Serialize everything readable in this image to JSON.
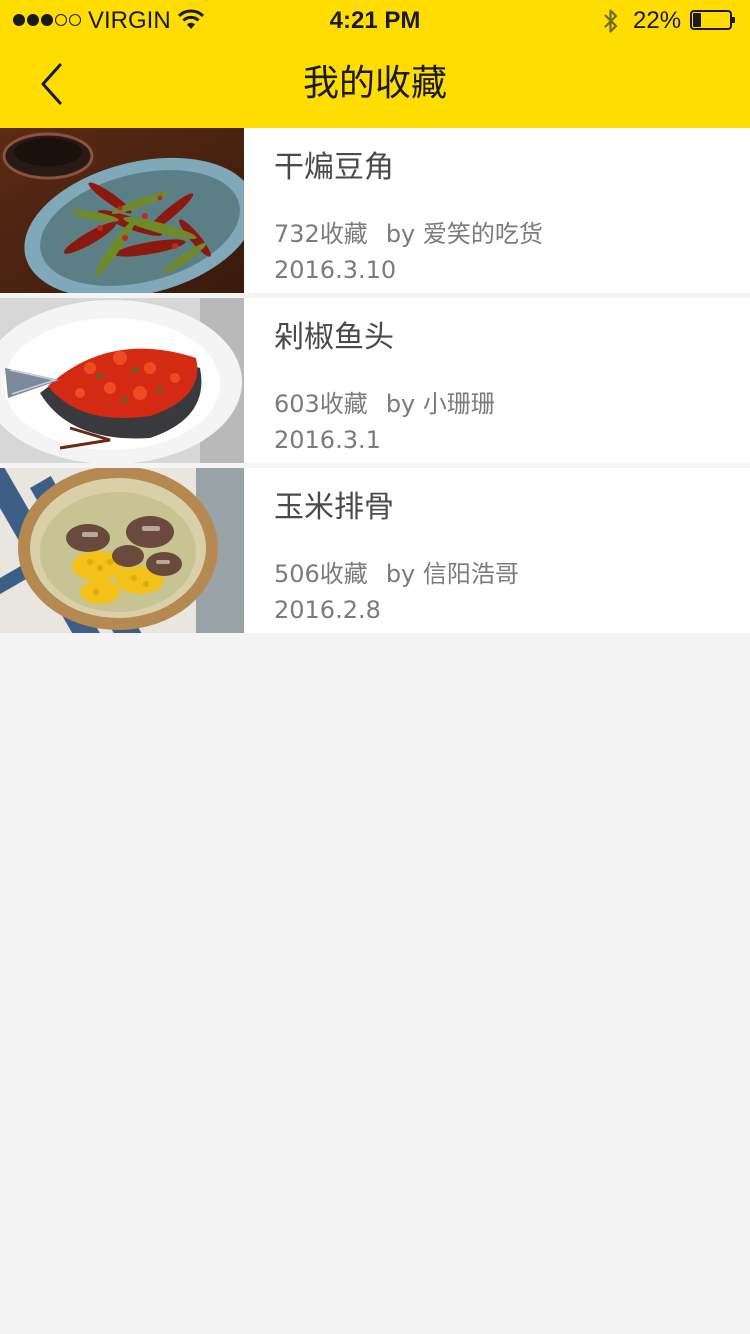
{
  "status_bar": {
    "carrier": "VIRGIN",
    "time": "4:21 PM",
    "battery_percent": "22%",
    "battery_level": 0.22,
    "signal_bars_filled": 3,
    "signal_bars_total": 5
  },
  "nav": {
    "title": "我的收藏",
    "back_icon": "chevron-left-icon"
  },
  "colors": {
    "header_bg": "#ffdd00",
    "page_bg": "#f4f4f4",
    "card_bg": "#ffffff",
    "title_text": "#4a4a4a",
    "meta_text": "#7b7b7b"
  },
  "favorites": [
    {
      "name": "干煸豆角",
      "collect_count": "732收藏",
      "by_prefix": "by",
      "author": "爱笑的吃货",
      "date": "2016.3.10"
    },
    {
      "name": "剁椒鱼头",
      "collect_count": "603收藏",
      "by_prefix": "by",
      "author": "小珊珊",
      "date": "2016.3.1"
    },
    {
      "name": "玉米排骨",
      "collect_count": "506收藏",
      "by_prefix": "by",
      "author": "信阳浩哥",
      "date": "2016.2.8"
    }
  ]
}
